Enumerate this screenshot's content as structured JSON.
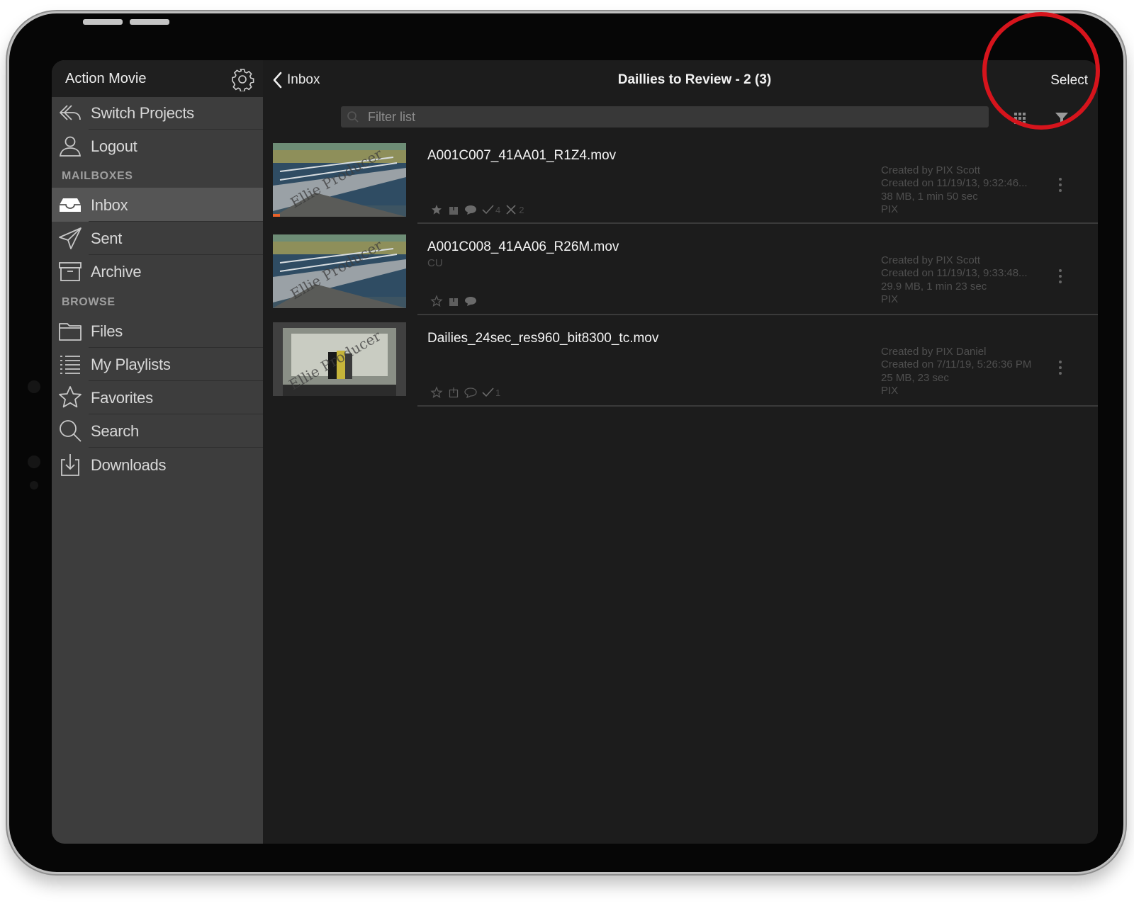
{
  "sidebar": {
    "project_title": "Action Movie",
    "top_items": [
      {
        "label": "Switch Projects",
        "icon": "reply-arrow-icon"
      },
      {
        "label": "Logout",
        "icon": "user-icon"
      }
    ],
    "mailboxes_label": "MAILBOXES",
    "mailbox_items": [
      {
        "label": "Inbox",
        "icon": "inbox-icon",
        "active": true
      },
      {
        "label": "Sent",
        "icon": "paper-plane-icon"
      },
      {
        "label": "Archive",
        "icon": "archive-box-icon"
      }
    ],
    "browse_label": "BROWSE",
    "browse_items": [
      {
        "label": "Files",
        "icon": "folder-icon"
      },
      {
        "label": "My Playlists",
        "icon": "playlist-icon"
      },
      {
        "label": "Favorites",
        "icon": "star-icon"
      },
      {
        "label": "Search",
        "icon": "search-icon"
      },
      {
        "label": "Downloads",
        "icon": "download-icon"
      }
    ]
  },
  "topbar": {
    "back_label": "Inbox",
    "title": "Daillies to Review - 2 (3)",
    "select_label": "Select"
  },
  "filter": {
    "placeholder": "Filter list"
  },
  "files": [
    {
      "name": "A001C007_41AA01_R1Z4.mov",
      "subtitle": "",
      "favorite": true,
      "approved_count": "4",
      "rejected_count": "2",
      "meta": [
        "Created by PIX Scott",
        "Created on 11/19/13, 9:32:46...",
        "38 MB, 1 min 50 sec",
        "PIX"
      ],
      "watermark": "Ellie Producer"
    },
    {
      "name": "A001C008_41AA06_R26M.mov",
      "subtitle": "CU",
      "favorite": false,
      "meta": [
        "Created by PIX Scott",
        "Created on 11/19/13, 9:33:48...",
        "29.9 MB, 1 min 23 sec",
        "PIX"
      ],
      "watermark": "Ellie Producer"
    },
    {
      "name": "Dailies_24sec_res960_bit8300_tc.mov",
      "subtitle": "",
      "favorite": false,
      "approved_count": "1",
      "meta": [
        "Created by PIX Daniel",
        "Created on 7/11/19, 5:26:36 PM",
        "25 MB, 23 sec",
        "PIX"
      ],
      "watermark": "Ellie Producer"
    }
  ],
  "colors": {
    "sidebar_bg": "#3d3d3d",
    "sidebar_active": "#555555",
    "main_bg": "#1c1c1c",
    "highlight_ring": "#d6141c",
    "progress_accent": "#e8622a"
  }
}
